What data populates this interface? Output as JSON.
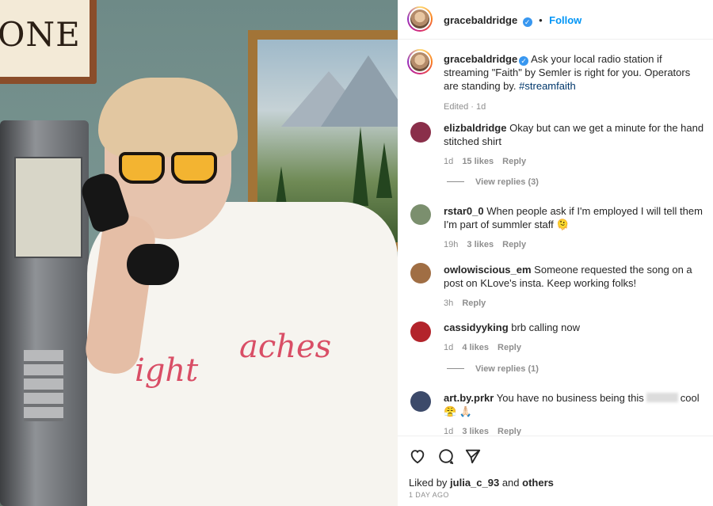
{
  "post": {
    "username": "gracebaldridge",
    "follow_label": "Follow",
    "separator": "•",
    "caption_text": "Ask your local radio station if streaming \"Faith\" by Semler is right for you. Operators are standing by.",
    "hashtag": "#streamfaith",
    "edited_meta": "Edited · 1d",
    "photo": {
      "sign_text": "ONE",
      "shirt_text_left": "ight",
      "shirt_text_right": "aches"
    }
  },
  "comments": [
    {
      "username": "elizbaldridge",
      "text": "Okay but can we get a minute for the hand stitched shirt",
      "time": "1d",
      "likes": "15 likes",
      "reply": "Reply",
      "avatar_color": "#8a2f4a"
    },
    {
      "username": "rstar0_0",
      "text": "When people ask if I'm employed I will tell them I'm part of summler staff 🫠",
      "time": "19h",
      "likes": "3 likes",
      "reply": "Reply",
      "avatar_color": "#7b8f6e"
    },
    {
      "username": "owlowiscious_em",
      "text": "Someone requested the song on a post on KLove's insta. Keep working folks!",
      "time": "3h",
      "reply": "Reply",
      "avatar_color": "#a06e44"
    },
    {
      "username": "cassidyyking",
      "text": "brb calling now",
      "time": "1d",
      "likes": "4 likes",
      "reply": "Reply",
      "avatar_color": "#b3242b"
    },
    {
      "username": "art.by.prkr",
      "text_before": "You have no business being this",
      "text_after": "cool 😤 🙏🏻",
      "time": "1d",
      "likes": "3 likes",
      "reply": "Reply",
      "avatar_color": "#3c4a6a"
    }
  ],
  "view_replies": [
    {
      "label": "View replies (3)"
    },
    {
      "label": "View replies (1)"
    }
  ],
  "actions": {
    "liked_prefix": "Liked by",
    "liked_user": "julia_c_93",
    "liked_and": "and",
    "liked_others": "others",
    "date": "1 DAY AGO"
  },
  "icons": [
    "heart-icon",
    "comment-icon",
    "share-icon",
    "verified-badge-icon"
  ],
  "colors": {
    "accent": "#0095f6",
    "hashtag": "#00376b",
    "muted": "#8e8e8e",
    "verified": "#3897f0"
  }
}
